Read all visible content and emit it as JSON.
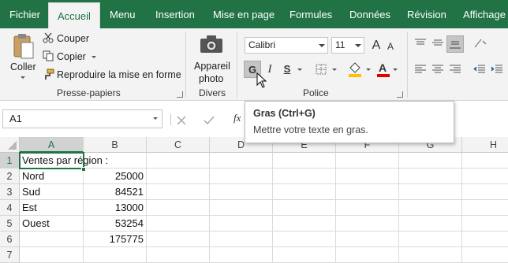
{
  "tabs": [
    "Fichier",
    "Accueil",
    "Menu",
    "Insertion",
    "Mise en page",
    "Formules",
    "Données",
    "Révision",
    "Affichage"
  ],
  "clipboard": {
    "paste": "Coller",
    "cut": "Couper",
    "copy": "Copier",
    "format_painter": "Reproduire la mise en forme",
    "group": "Presse-papiers"
  },
  "misc": {
    "photo_line1": "Appareil",
    "photo_line2": "photo",
    "group": "Divers"
  },
  "font": {
    "name": "Calibri",
    "size": "11",
    "bold": "G",
    "italic": "I",
    "underline": "S",
    "group": "Police",
    "fill_color": "#FFC000",
    "font_color": "#E00000"
  },
  "tooltip": {
    "title": "Gras (Ctrl+G)",
    "body": "Mettre votre texte en gras."
  },
  "formula_bar": {
    "name_box": "A1",
    "fx": "fx"
  },
  "columns": [
    "A",
    "B",
    "C",
    "D",
    "E",
    "F",
    "G",
    "H"
  ],
  "rows": [
    {
      "num": "1",
      "a": "Ventes par région :",
      "b": ""
    },
    {
      "num": "2",
      "a": "Nord",
      "b": "25000"
    },
    {
      "num": "3",
      "a": "Sud",
      "b": "84521"
    },
    {
      "num": "4",
      "a": "Est",
      "b": "13000"
    },
    {
      "num": "5",
      "a": "Ouest",
      "b": "53254"
    },
    {
      "num": "6",
      "a": "",
      "b": "175775"
    },
    {
      "num": "7",
      "a": "",
      "b": ""
    }
  ],
  "colors": {
    "ribbon_green": "#217346",
    "selection_green": "#217346"
  }
}
